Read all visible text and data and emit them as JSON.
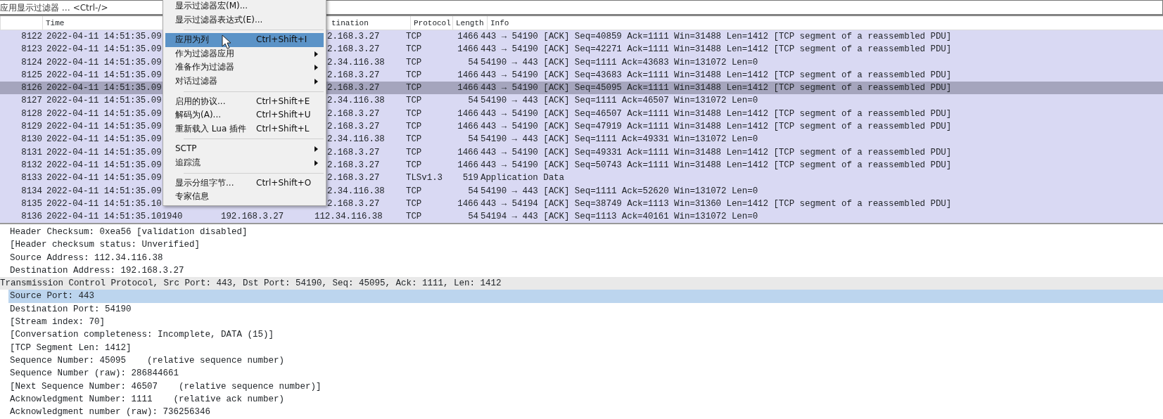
{
  "filter_bar": {
    "placeholder": "应用显示过滤器 … <Ctrl-/>"
  },
  "packet_list": {
    "columns": [
      "Time",
      "tination",
      "Protocol",
      "Length",
      "Info"
    ],
    "rows": [
      {
        "no": "8122",
        "time": "2022-04-11 14:51:35.09",
        "destination": "2.168.3.27",
        "protocol": "TCP",
        "length": "1466",
        "info": "443 → 54190 [ACK] Seq=40859 Ack=1111 Win=31488 Len=1412 [TCP segment of a reassembled PDU]",
        "selected": false
      },
      {
        "no": "8123",
        "time": "2022-04-11 14:51:35.09",
        "destination": "2.168.3.27",
        "protocol": "TCP",
        "length": "1466",
        "info": "443 → 54190 [ACK] Seq=42271 Ack=1111 Win=31488 Len=1412 [TCP segment of a reassembled PDU]",
        "selected": false
      },
      {
        "no": "8124",
        "time": "2022-04-11 14:51:35.09",
        "destination": "2.34.116.38",
        "protocol": "TCP",
        "length": "54",
        "info": "54190 → 443 [ACK] Seq=1111 Ack=43683 Win=131072 Len=0",
        "selected": false
      },
      {
        "no": "8125",
        "time": "2022-04-11 14:51:35.09",
        "destination": "2.168.3.27",
        "protocol": "TCP",
        "length": "1466",
        "info": "443 → 54190 [ACK] Seq=43683 Ack=1111 Win=31488 Len=1412 [TCP segment of a reassembled PDU]",
        "selected": false
      },
      {
        "no": "8126",
        "time": "2022-04-11 14:51:35.09",
        "destination": "2.168.3.27",
        "protocol": "TCP",
        "length": "1466",
        "info": "443 → 54190 [ACK] Seq=45095 Ack=1111 Win=31488 Len=1412 [TCP segment of a reassembled PDU]",
        "selected": true
      },
      {
        "no": "8127",
        "time": "2022-04-11 14:51:35.09",
        "destination": "2.34.116.38",
        "protocol": "TCP",
        "length": "54",
        "info": "54190 → 443 [ACK] Seq=1111 Ack=46507 Win=131072 Len=0",
        "selected": false
      },
      {
        "no": "8128",
        "time": "2022-04-11 14:51:35.09",
        "destination": "2.168.3.27",
        "protocol": "TCP",
        "length": "1466",
        "info": "443 → 54190 [ACK] Seq=46507 Ack=1111 Win=31488 Len=1412 [TCP segment of a reassembled PDU]",
        "selected": false
      },
      {
        "no": "8129",
        "time": "2022-04-11 14:51:35.09",
        "destination": "2.168.3.27",
        "protocol": "TCP",
        "length": "1466",
        "info": "443 → 54190 [ACK] Seq=47919 Ack=1111 Win=31488 Len=1412 [TCP segment of a reassembled PDU]",
        "selected": false
      },
      {
        "no": "8130",
        "time": "2022-04-11 14:51:35.09",
        "destination": "2.34.116.38",
        "protocol": "TCP",
        "length": "54",
        "info": "54190 → 443 [ACK] Seq=1111 Ack=49331 Win=131072 Len=0",
        "selected": false
      },
      {
        "no": "8131",
        "time": "2022-04-11 14:51:35.09",
        "destination": "2.168.3.27",
        "protocol": "TCP",
        "length": "1466",
        "info": "443 → 54190 [ACK] Seq=49331 Ack=1111 Win=31488 Len=1412 [TCP segment of a reassembled PDU]",
        "selected": false
      },
      {
        "no": "8132",
        "time": "2022-04-11 14:51:35.09",
        "destination": "2.168.3.27",
        "protocol": "TCP",
        "length": "1466",
        "info": "443 → 54190 [ACK] Seq=50743 Ack=1111 Win=31488 Len=1412 [TCP segment of a reassembled PDU]",
        "selected": false
      },
      {
        "no": "8133",
        "time": "2022-04-11 14:51:35.09",
        "destination": "2.168.3.27",
        "protocol": "TLSv1.3",
        "length": "519",
        "info": "Application Data",
        "selected": false
      },
      {
        "no": "8134",
        "time": "2022-04-11 14:51:35.09",
        "destination": "2.34.116.38",
        "protocol": "TCP",
        "length": "54",
        "info": "54190 → 443 [ACK] Seq=1111 Ack=52620 Win=131072 Len=0",
        "selected": false
      },
      {
        "no": "8135",
        "time": "2022-04-11 14:51:35.10",
        "destination": "2.168.3.27",
        "protocol": "TCP",
        "length": "1466",
        "info": "443 → 54194 [ACK] Seq=38749 Ack=1113 Win=31360 Len=1412 [TCP segment of a reassembled PDU]",
        "selected": false
      },
      {
        "no": "8136",
        "time": "2022-04-11 14:51:35.101940",
        "source": "192.168.3.27",
        "destination": "112.34.116.38",
        "protocol": "TCP",
        "length": "54",
        "info": "54194 → 443 [ACK] Seq=1113 Ack=40161 Win=131072 Len=0",
        "selected": false
      }
    ]
  },
  "context_menu": {
    "items": [
      {
        "kind": "item",
        "label": "显示过滤器宏(M)...",
        "submenu": false,
        "selected": false
      },
      {
        "kind": "item",
        "label": "显示过滤器表达式(E)...",
        "submenu": false,
        "selected": false
      },
      {
        "kind": "separator"
      },
      {
        "kind": "item",
        "label": "应用为列",
        "shortcut": "Ctrl+Shift+I",
        "submenu": false,
        "selected": true
      },
      {
        "kind": "item",
        "label": "作为过滤器应用",
        "submenu": true,
        "selected": false
      },
      {
        "kind": "item",
        "label": "准备作为过滤器",
        "submenu": true,
        "selected": false
      },
      {
        "kind": "item",
        "label": "对话过滤器",
        "submenu": true,
        "selected": false
      },
      {
        "kind": "separator"
      },
      {
        "kind": "item",
        "label": "启用的协议...",
        "shortcut": "Ctrl+Shift+E",
        "submenu": false,
        "selected": false
      },
      {
        "kind": "item",
        "label": "解码为(A)...",
        "shortcut": "Ctrl+Shift+U",
        "submenu": false,
        "selected": false
      },
      {
        "kind": "item",
        "label": "重新载入 Lua 插件",
        "shortcut": "Ctrl+Shift+L",
        "submenu": false,
        "selected": false
      },
      {
        "kind": "separator"
      },
      {
        "kind": "item",
        "label": "SCTP",
        "submenu": true,
        "selected": false
      },
      {
        "kind": "item",
        "label": "追踪流",
        "submenu": true,
        "selected": false
      },
      {
        "kind": "separator"
      },
      {
        "kind": "item",
        "label": "显示分组字节...",
        "shortcut": "Ctrl+Shift+O",
        "submenu": false,
        "selected": false
      },
      {
        "kind": "item",
        "label": "专家信息",
        "submenu": false,
        "selected": false
      }
    ]
  },
  "detail": {
    "ip_fields": [
      {
        "text": "Header Checksum: 0xea56 [validation disabled]",
        "selected": false
      },
      {
        "text": "[Header checksum status: Unverified]",
        "selected": false
      },
      {
        "text": "Source Address: 112.34.116.38",
        "selected": false
      },
      {
        "text": "Destination Address: 192.168.3.27",
        "selected": false
      }
    ],
    "tcp": {
      "text": "Transmission Control Protocol, Src Port: 443, Dst Port: 54190, Seq: 45095, Ack: 1111, Len: 1412",
      "children": [
        {
          "text": "Source Port: 443",
          "selected": true
        },
        {
          "text": "Destination Port: 54190",
          "selected": false
        },
        {
          "text": "[Stream index: 70]",
          "selected": false
        },
        {
          "text": "[Conversation completeness: Incomplete, DATA (15)]",
          "selected": false
        },
        {
          "text": "[TCP Segment Len: 1412]",
          "selected": false
        },
        {
          "text": "Sequence Number: 45095    (relative sequence number)",
          "selected": false
        },
        {
          "text": "Sequence Number (raw): 286844661",
          "selected": false
        },
        {
          "text": "[Next Sequence Number: 46507    (relative sequence number)]",
          "selected": false
        },
        {
          "text": "Acknowledgment Number: 1111    (relative ack number)",
          "selected": false
        },
        {
          "text": "Acknowledgment number (raw): 736256346",
          "selected": false
        }
      ]
    }
  }
}
